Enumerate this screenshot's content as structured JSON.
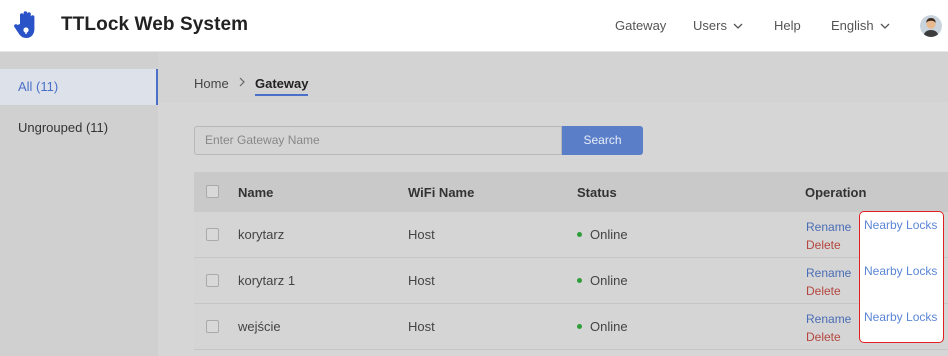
{
  "header": {
    "title": "TTLock Web System",
    "nav": {
      "gateway": "Gateway",
      "users": "Users",
      "help": "Help",
      "language": "English"
    }
  },
  "sidebar": {
    "items": [
      {
        "label": "All (11)",
        "active": true
      },
      {
        "label": "Ungrouped (11)",
        "active": false
      }
    ]
  },
  "breadcrumb": {
    "home": "Home",
    "current": "Gateway"
  },
  "search": {
    "placeholder": "Enter Gateway Name",
    "button": "Search"
  },
  "table": {
    "columns": [
      "Name",
      "WiFi Name",
      "Status",
      "Operation"
    ],
    "rows": [
      {
        "name": "korytarz",
        "wifi": "Host",
        "status": "Online"
      },
      {
        "name": "korytarz 1",
        "wifi": "Host",
        "status": "Online"
      },
      {
        "name": "wejście",
        "wifi": "Host",
        "status": "Online"
      }
    ],
    "operations": {
      "rename": "Rename",
      "delete": "Delete",
      "nearby": "Nearby Locks"
    }
  },
  "colors": {
    "accent": "#4a6fc8",
    "online": "#2f9e3a",
    "delete": "#b5463f",
    "highlight_border": "#e02020"
  },
  "icons": [
    "hand-logo-icon",
    "chevron-down-icon",
    "chevron-right-icon",
    "user-avatar-icon"
  ]
}
